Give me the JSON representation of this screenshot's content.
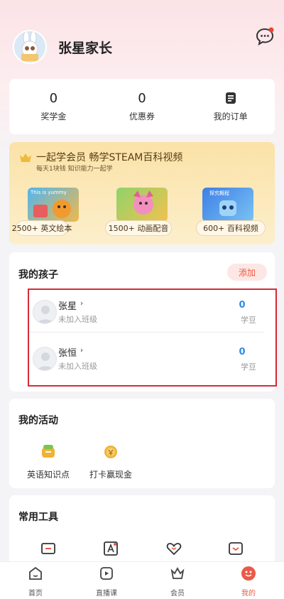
{
  "profile": {
    "username": "张星家长"
  },
  "stats": [
    {
      "value": "0",
      "label": "奖学金"
    },
    {
      "value": "0",
      "label": "优惠券"
    },
    {
      "value": "",
      "label": "我的订单"
    }
  ],
  "member": {
    "title": "一起学会员 畅学STEAM百科视频",
    "subtitle": "每天1块钱 知识能力一起学",
    "items": [
      {
        "label": "2500+ 英文绘本",
        "thumb_text": "This is yummy"
      },
      {
        "label": "1500+ 动画配音"
      },
      {
        "label": "600+ 百科视频",
        "thumb_text": "探究概程"
      }
    ]
  },
  "kids": {
    "title": "我的孩子",
    "add_label": "添加",
    "list": [
      {
        "name": "张星",
        "status": "未加入班级",
        "count": "0",
        "unit": "学豆"
      },
      {
        "name": "张恒",
        "status": "未加入班级",
        "count": "0",
        "unit": "学豆"
      }
    ]
  },
  "activities": {
    "title": "我的活动",
    "items": [
      {
        "label": "英语知识点",
        "icon": "english-knowledge-icon"
      },
      {
        "label": "打卡赢现金",
        "icon": "checkin-cash-icon"
      }
    ]
  },
  "tools": {
    "title": "常用工具",
    "icons": [
      "ticket-icon",
      "font-icon",
      "heart-icon",
      "message-icon"
    ]
  },
  "tabbar": {
    "items": [
      {
        "label": "首页",
        "icon": "home-icon",
        "active": false
      },
      {
        "label": "直播课",
        "icon": "live-class-icon",
        "active": false
      },
      {
        "label": "会员",
        "icon": "crown-icon",
        "active": false
      },
      {
        "label": "我的",
        "icon": "profile-icon",
        "active": true
      }
    ]
  },
  "colors": {
    "accent": "#ea5a47",
    "blue": "#2f8be6",
    "highlight": "#d62b3a",
    "gold": "#fbe2a7"
  }
}
